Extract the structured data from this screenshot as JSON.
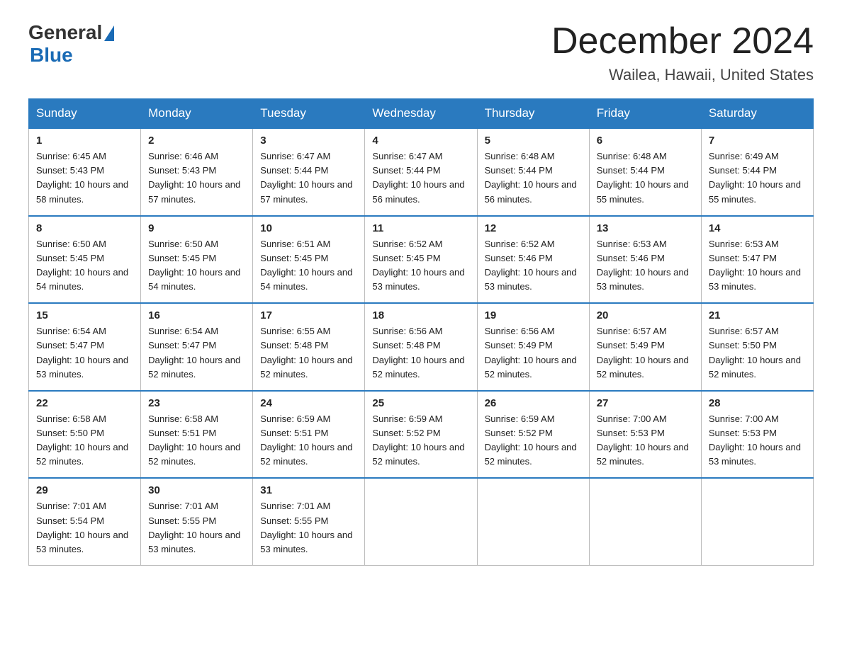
{
  "logo": {
    "text_general": "General",
    "text_blue": "Blue"
  },
  "header": {
    "month_year": "December 2024",
    "location": "Wailea, Hawaii, United States"
  },
  "days_of_week": [
    "Sunday",
    "Monday",
    "Tuesday",
    "Wednesday",
    "Thursday",
    "Friday",
    "Saturday"
  ],
  "weeks": [
    [
      {
        "day": "1",
        "sunrise": "6:45 AM",
        "sunset": "5:43 PM",
        "daylight": "10 hours and 58 minutes."
      },
      {
        "day": "2",
        "sunrise": "6:46 AM",
        "sunset": "5:43 PM",
        "daylight": "10 hours and 57 minutes."
      },
      {
        "day": "3",
        "sunrise": "6:47 AM",
        "sunset": "5:44 PM",
        "daylight": "10 hours and 57 minutes."
      },
      {
        "day": "4",
        "sunrise": "6:47 AM",
        "sunset": "5:44 PM",
        "daylight": "10 hours and 56 minutes."
      },
      {
        "day": "5",
        "sunrise": "6:48 AM",
        "sunset": "5:44 PM",
        "daylight": "10 hours and 56 minutes."
      },
      {
        "day": "6",
        "sunrise": "6:48 AM",
        "sunset": "5:44 PM",
        "daylight": "10 hours and 55 minutes."
      },
      {
        "day": "7",
        "sunrise": "6:49 AM",
        "sunset": "5:44 PM",
        "daylight": "10 hours and 55 minutes."
      }
    ],
    [
      {
        "day": "8",
        "sunrise": "6:50 AM",
        "sunset": "5:45 PM",
        "daylight": "10 hours and 54 minutes."
      },
      {
        "day": "9",
        "sunrise": "6:50 AM",
        "sunset": "5:45 PM",
        "daylight": "10 hours and 54 minutes."
      },
      {
        "day": "10",
        "sunrise": "6:51 AM",
        "sunset": "5:45 PM",
        "daylight": "10 hours and 54 minutes."
      },
      {
        "day": "11",
        "sunrise": "6:52 AM",
        "sunset": "5:45 PM",
        "daylight": "10 hours and 53 minutes."
      },
      {
        "day": "12",
        "sunrise": "6:52 AM",
        "sunset": "5:46 PM",
        "daylight": "10 hours and 53 minutes."
      },
      {
        "day": "13",
        "sunrise": "6:53 AM",
        "sunset": "5:46 PM",
        "daylight": "10 hours and 53 minutes."
      },
      {
        "day": "14",
        "sunrise": "6:53 AM",
        "sunset": "5:47 PM",
        "daylight": "10 hours and 53 minutes."
      }
    ],
    [
      {
        "day": "15",
        "sunrise": "6:54 AM",
        "sunset": "5:47 PM",
        "daylight": "10 hours and 53 minutes."
      },
      {
        "day": "16",
        "sunrise": "6:54 AM",
        "sunset": "5:47 PM",
        "daylight": "10 hours and 52 minutes."
      },
      {
        "day": "17",
        "sunrise": "6:55 AM",
        "sunset": "5:48 PM",
        "daylight": "10 hours and 52 minutes."
      },
      {
        "day": "18",
        "sunrise": "6:56 AM",
        "sunset": "5:48 PM",
        "daylight": "10 hours and 52 minutes."
      },
      {
        "day": "19",
        "sunrise": "6:56 AM",
        "sunset": "5:49 PM",
        "daylight": "10 hours and 52 minutes."
      },
      {
        "day": "20",
        "sunrise": "6:57 AM",
        "sunset": "5:49 PM",
        "daylight": "10 hours and 52 minutes."
      },
      {
        "day": "21",
        "sunrise": "6:57 AM",
        "sunset": "5:50 PM",
        "daylight": "10 hours and 52 minutes."
      }
    ],
    [
      {
        "day": "22",
        "sunrise": "6:58 AM",
        "sunset": "5:50 PM",
        "daylight": "10 hours and 52 minutes."
      },
      {
        "day": "23",
        "sunrise": "6:58 AM",
        "sunset": "5:51 PM",
        "daylight": "10 hours and 52 minutes."
      },
      {
        "day": "24",
        "sunrise": "6:59 AM",
        "sunset": "5:51 PM",
        "daylight": "10 hours and 52 minutes."
      },
      {
        "day": "25",
        "sunrise": "6:59 AM",
        "sunset": "5:52 PM",
        "daylight": "10 hours and 52 minutes."
      },
      {
        "day": "26",
        "sunrise": "6:59 AM",
        "sunset": "5:52 PM",
        "daylight": "10 hours and 52 minutes."
      },
      {
        "day": "27",
        "sunrise": "7:00 AM",
        "sunset": "5:53 PM",
        "daylight": "10 hours and 52 minutes."
      },
      {
        "day": "28",
        "sunrise": "7:00 AM",
        "sunset": "5:53 PM",
        "daylight": "10 hours and 53 minutes."
      }
    ],
    [
      {
        "day": "29",
        "sunrise": "7:01 AM",
        "sunset": "5:54 PM",
        "daylight": "10 hours and 53 minutes."
      },
      {
        "day": "30",
        "sunrise": "7:01 AM",
        "sunset": "5:55 PM",
        "daylight": "10 hours and 53 minutes."
      },
      {
        "day": "31",
        "sunrise": "7:01 AM",
        "sunset": "5:55 PM",
        "daylight": "10 hours and 53 minutes."
      },
      null,
      null,
      null,
      null
    ]
  ]
}
